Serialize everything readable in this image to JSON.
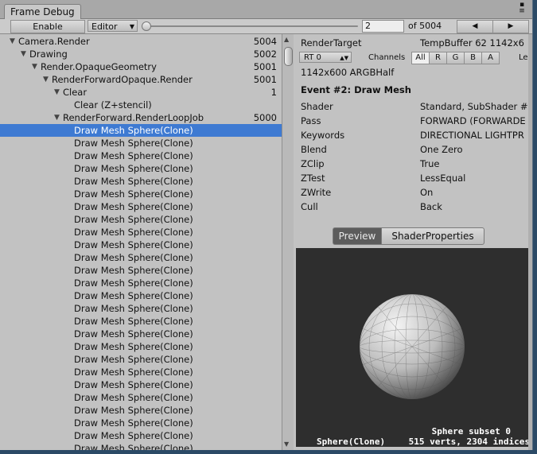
{
  "window": {
    "tab_title": "Frame Debug"
  },
  "toolbar": {
    "enable_label": "Enable",
    "editor_label": "Editor",
    "event_index": "2",
    "event_total": "of 5004",
    "prev_glyph": "◀",
    "next_glyph": "▶"
  },
  "tree": {
    "rows": [
      {
        "label": "Camera.Render",
        "count": "5004",
        "depth": 0,
        "expanded": true
      },
      {
        "label": "Drawing",
        "count": "5002",
        "depth": 1,
        "expanded": true
      },
      {
        "label": "Render.OpaqueGeometry",
        "count": "5001",
        "depth": 2,
        "expanded": true
      },
      {
        "label": "RenderForwardOpaque.Render",
        "count": "5001",
        "depth": 3,
        "expanded": true
      },
      {
        "label": "Clear",
        "count": "1",
        "depth": 4,
        "expanded": true
      },
      {
        "label": "Clear (Z+stencil)",
        "count": "",
        "depth": 5,
        "expanded": null
      },
      {
        "label": "RenderForward.RenderLoopJob",
        "count": "5000",
        "depth": 4,
        "expanded": true
      },
      {
        "label": "Draw Mesh Sphere(Clone)",
        "count": "",
        "depth": 5,
        "selected": true
      },
      {
        "label": "Draw Mesh Sphere(Clone)",
        "count": "",
        "depth": 5
      },
      {
        "label": "Draw Mesh Sphere(Clone)",
        "count": "",
        "depth": 5
      },
      {
        "label": "Draw Mesh Sphere(Clone)",
        "count": "",
        "depth": 5
      },
      {
        "label": "Draw Mesh Sphere(Clone)",
        "count": "",
        "depth": 5
      },
      {
        "label": "Draw Mesh Sphere(Clone)",
        "count": "",
        "depth": 5
      },
      {
        "label": "Draw Mesh Sphere(Clone)",
        "count": "",
        "depth": 5
      },
      {
        "label": "Draw Mesh Sphere(Clone)",
        "count": "",
        "depth": 5
      },
      {
        "label": "Draw Mesh Sphere(Clone)",
        "count": "",
        "depth": 5
      },
      {
        "label": "Draw Mesh Sphere(Clone)",
        "count": "",
        "depth": 5
      },
      {
        "label": "Draw Mesh Sphere(Clone)",
        "count": "",
        "depth": 5
      },
      {
        "label": "Draw Mesh Sphere(Clone)",
        "count": "",
        "depth": 5
      },
      {
        "label": "Draw Mesh Sphere(Clone)",
        "count": "",
        "depth": 5
      },
      {
        "label": "Draw Mesh Sphere(Clone)",
        "count": "",
        "depth": 5
      },
      {
        "label": "Draw Mesh Sphere(Clone)",
        "count": "",
        "depth": 5
      },
      {
        "label": "Draw Mesh Sphere(Clone)",
        "count": "",
        "depth": 5
      },
      {
        "label": "Draw Mesh Sphere(Clone)",
        "count": "",
        "depth": 5
      },
      {
        "label": "Draw Mesh Sphere(Clone)",
        "count": "",
        "depth": 5
      },
      {
        "label": "Draw Mesh Sphere(Clone)",
        "count": "",
        "depth": 5
      },
      {
        "label": "Draw Mesh Sphere(Clone)",
        "count": "",
        "depth": 5
      },
      {
        "label": "Draw Mesh Sphere(Clone)",
        "count": "",
        "depth": 5
      },
      {
        "label": "Draw Mesh Sphere(Clone)",
        "count": "",
        "depth": 5
      },
      {
        "label": "Draw Mesh Sphere(Clone)",
        "count": "",
        "depth": 5
      },
      {
        "label": "Draw Mesh Sphere(Clone)",
        "count": "",
        "depth": 5
      },
      {
        "label": "Draw Mesh Sphere(Clone)",
        "count": "",
        "depth": 5
      },
      {
        "label": "Draw Mesh Sphere(Clone)",
        "count": "",
        "depth": 5
      },
      {
        "label": "Draw Mesh Sphere(Clone)",
        "count": "",
        "depth": 5
      }
    ]
  },
  "details": {
    "render_target_label": "RenderTarget",
    "render_target_value": "TempBuffer 62 1142x6",
    "rt_dropdown": "RT 0",
    "channels_label": "Channels",
    "channel_buttons": [
      "All",
      "R",
      "G",
      "B",
      "A"
    ],
    "levels_label": "Le",
    "resolution": "1142x600 ARGBHalf",
    "event_title": "Event #2: Draw Mesh",
    "props": [
      {
        "key": "Shader",
        "value": "Standard, SubShader #"
      },
      {
        "key": "Pass",
        "value": "FORWARD (FORWARDE"
      },
      {
        "key": "Keywords",
        "value": "DIRECTIONAL LIGHTPR"
      },
      {
        "key": "Blend",
        "value": "One Zero"
      },
      {
        "key": "ZClip",
        "value": "True"
      },
      {
        "key": "ZTest",
        "value": "LessEqual"
      },
      {
        "key": "ZWrite",
        "value": "On"
      },
      {
        "key": "Cull",
        "value": "Back"
      }
    ],
    "tab_preview": "Preview",
    "tab_shader_properties": "ShaderProperties",
    "preview_object": "Sphere(Clone)",
    "preview_subset": "Sphere subset 0",
    "preview_stats": "515 verts, 2304 indices"
  },
  "colors": {
    "selection": "#3e7ad2",
    "panel": "#c2c2c2",
    "preview_bg": "#2e2e2e"
  }
}
